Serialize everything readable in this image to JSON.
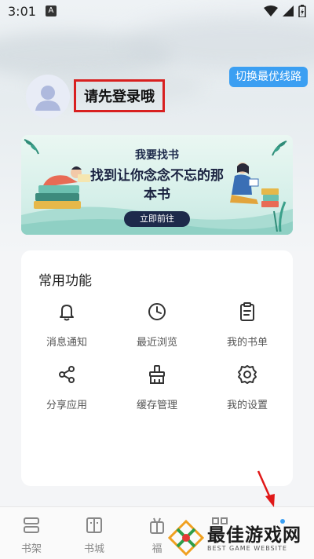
{
  "status": {
    "time": "3:01",
    "badge": "A"
  },
  "header": {
    "switch_label": "切换最优线路"
  },
  "profile": {
    "login_text": "请先登录哦"
  },
  "banner": {
    "title": "我要找书",
    "subtitle": "找到让你念念不忘的那本书",
    "button": "立即前往"
  },
  "functions": {
    "title": "常用功能",
    "items": [
      {
        "label": "消息通知",
        "icon": "bell-icon"
      },
      {
        "label": "最近浏览",
        "icon": "clock-icon"
      },
      {
        "label": "我的书单",
        "icon": "clipboard-icon"
      },
      {
        "label": "分享应用",
        "icon": "share-icon"
      },
      {
        "label": "缓存管理",
        "icon": "broom-icon"
      },
      {
        "label": "我的设置",
        "icon": "gear-icon"
      }
    ]
  },
  "bottom_nav": {
    "items": [
      {
        "label": "书架",
        "icon": "shelf-icon"
      },
      {
        "label": "书城",
        "icon": "book-icon"
      },
      {
        "label": "福",
        "icon": "gift-icon"
      },
      {
        "label": "",
        "icon": "grid-icon"
      },
      {
        "label": "",
        "icon": "profile-icon"
      }
    ]
  },
  "watermark": {
    "title": "最佳游戏网",
    "subtitle": "BEST GAME WEBSITE"
  },
  "colors": {
    "accent": "#3b9ff2",
    "highlight": "#d82020",
    "banner_dark": "#1d2a4b"
  }
}
